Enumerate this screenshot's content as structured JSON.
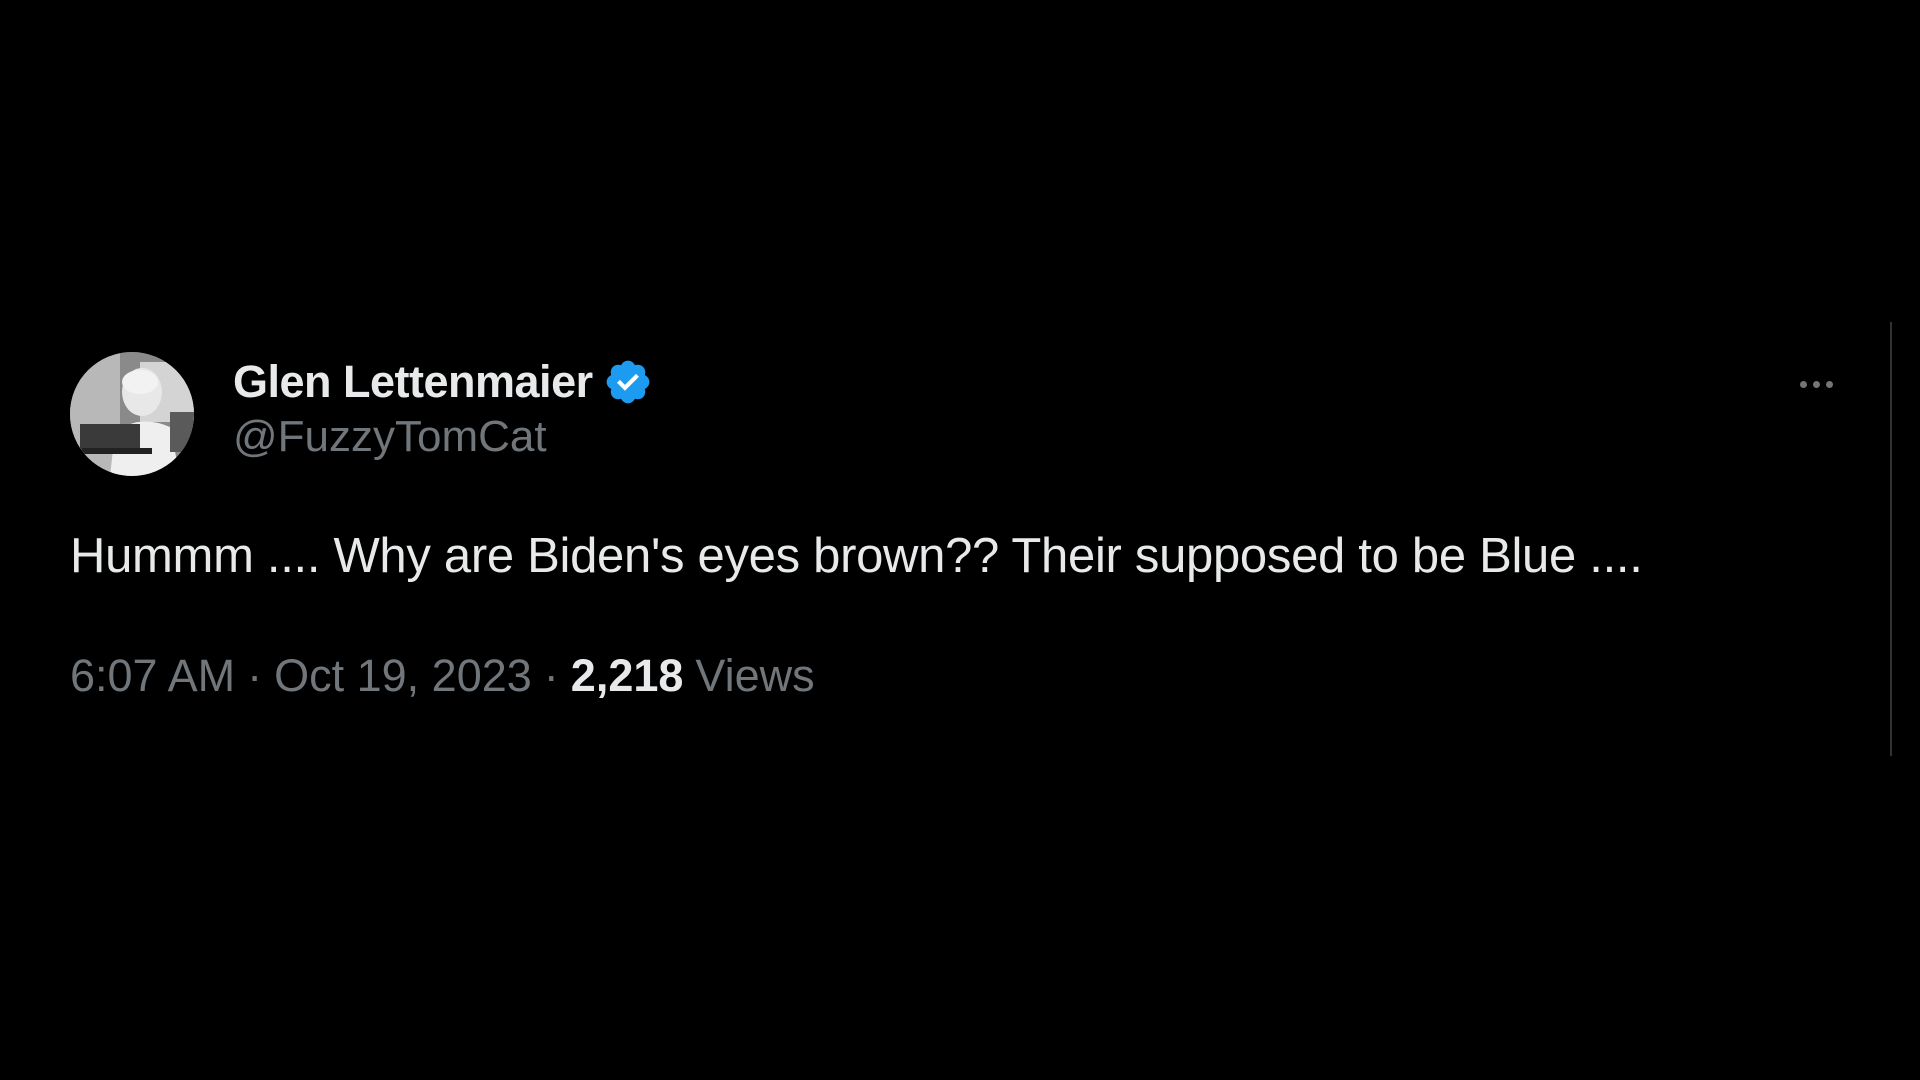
{
  "tweet": {
    "author": {
      "display_name": "Glen Lettenmaier",
      "handle": "@FuzzyTomCat",
      "verified": true,
      "verified_color": "#1d9bf0"
    },
    "text": "Hummm .... Why are Biden's eyes brown?? Their supposed to be Blue ....",
    "time": "6:07 AM",
    "separator": "·",
    "date": "Oct 19, 2023",
    "views_count": "2,218",
    "views_label": "Views"
  },
  "colors": {
    "background": "#000000",
    "primary_text": "#e7e9ea",
    "secondary_text": "#71767b"
  },
  "icons": {
    "more": "more-horizontal-icon",
    "verified": "verified-badge-icon"
  }
}
